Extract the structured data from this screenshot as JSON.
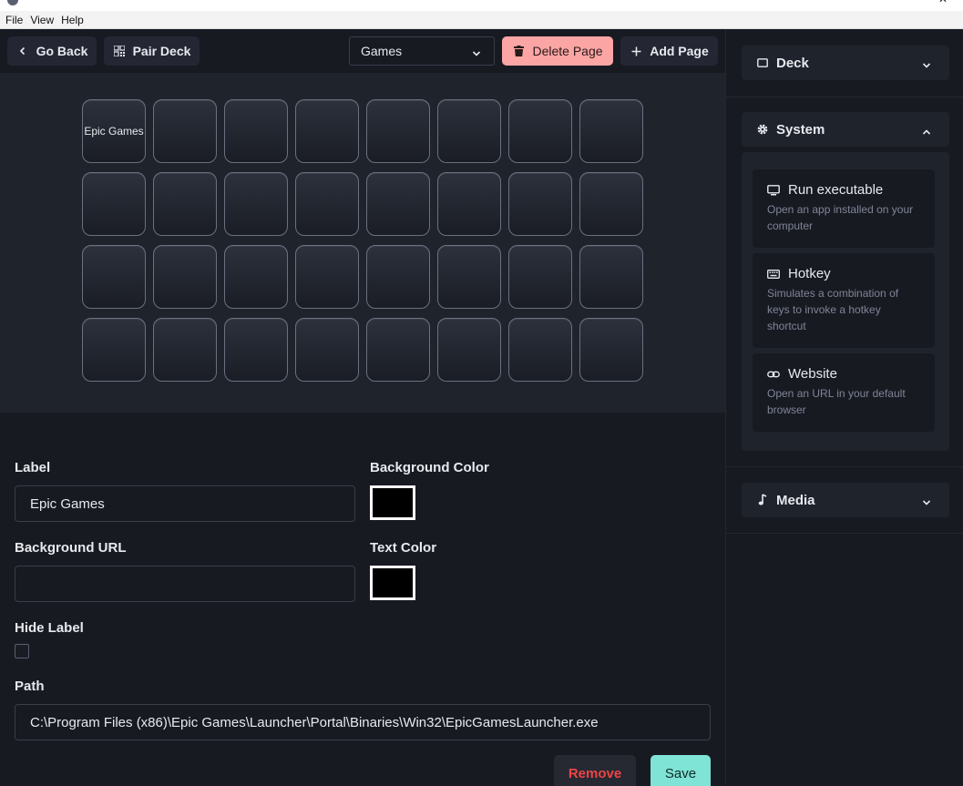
{
  "menu": [
    "File",
    "View",
    "Help"
  ],
  "toolbar": {
    "go_back": "Go Back",
    "pair_deck": "Pair Deck",
    "page_select": "Games",
    "delete_page": "Delete Page",
    "add_page": "Add Page"
  },
  "deck": {
    "rows": 4,
    "cols": 8,
    "keys": [
      "Epic Games"
    ]
  },
  "form": {
    "label_title": "Label",
    "label_value": "Epic Games",
    "background_color_title": "Background Color",
    "background_color": "#000000",
    "background_url_title": "Background URL",
    "background_url_value": "",
    "text_color_title": "Text Color",
    "text_color": "#000000",
    "hide_label_title": "Hide Label",
    "hide_label": false,
    "path_title": "Path",
    "path_value": "C:\\Program Files (x86)\\Epic Games\\Launcher\\Portal\\Binaries\\Win32\\EpicGamesLauncher.exe",
    "remove_label": "Remove",
    "save_label": "Save"
  },
  "sidebar": {
    "deck_title": "Deck",
    "system_title": "System",
    "media_title": "Media",
    "actions": [
      {
        "title": "Run executable",
        "desc": "Open an app installed on your computer",
        "icon": "monitor-icon"
      },
      {
        "title": "Hotkey",
        "desc": "Simulates a combination of keys to invoke a hotkey shortcut",
        "icon": "keyboard-icon"
      },
      {
        "title": "Website",
        "desc": "Open an URL in your default browser",
        "icon": "link-icon"
      }
    ]
  },
  "colors": {
    "danger": "#fca5a5",
    "save": "#7fe3d6",
    "remove_text": "#ef4444"
  }
}
